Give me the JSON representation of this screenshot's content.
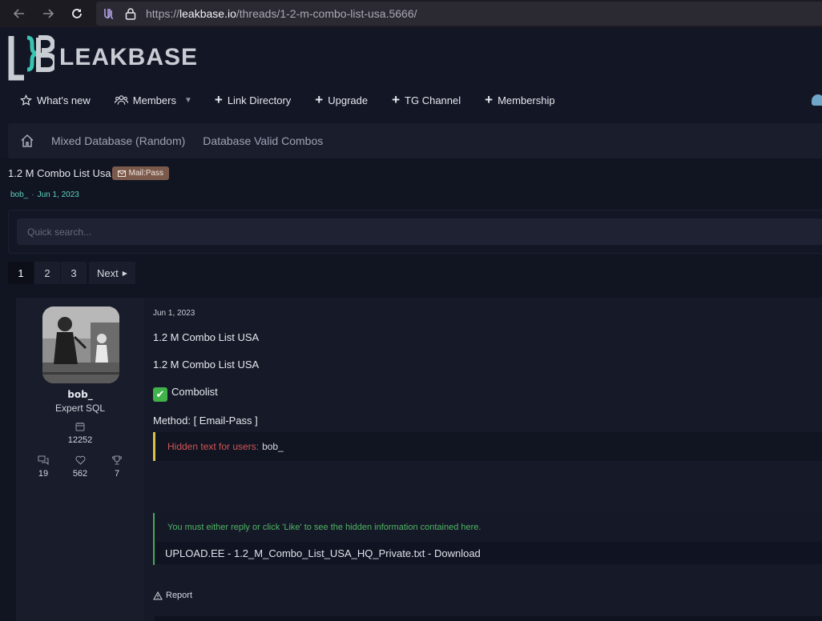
{
  "browser": {
    "url_host": "leakbase.io",
    "url_path": "/threads/1-2-m-combo-list-usa.5666/",
    "back_icon": "arrow-left-icon",
    "forward_icon": "arrow-right-icon",
    "reload_icon": "reload-icon"
  },
  "header": {
    "logo_text": "LEAKBASE",
    "nav": [
      {
        "label": "What's new",
        "icon": "star-icon"
      },
      {
        "label": "Members",
        "icon": "users-icon"
      },
      {
        "label": "Link Directory",
        "icon": "plus-icon"
      },
      {
        "label": "Upgrade",
        "icon": "plus-icon"
      },
      {
        "label": "TG Channel",
        "icon": "plus-icon"
      },
      {
        "label": "Membership",
        "icon": "plus-icon"
      }
    ]
  },
  "breadcrumb": {
    "items": [
      "Mixed Database (Random)",
      "Database Valid Combos"
    ]
  },
  "thread": {
    "title": "1.2 M Combo List Usa",
    "prefix": "Mail:Pass",
    "author": "bob_",
    "date": "Jun 1, 2023"
  },
  "search": {
    "placeholder": "Quick search..."
  },
  "pagination": {
    "pages": [
      "1",
      "2",
      "3"
    ],
    "next_label": "Next"
  },
  "post": {
    "user": {
      "name": "bob_",
      "title": "Expert SQL",
      "joined_stat": "12252",
      "messages": "19",
      "reactions": "562",
      "points": "7"
    },
    "date": "Jun 1, 2023",
    "line1": "1.2 M Combo List USA",
    "line2": "1.2 M Combo List USA",
    "line3": "Combolist",
    "method": "Method: [ Email-Pass ]",
    "hidden_label": "Hidden text for users:",
    "hidden_user": "bob_",
    "reply_notice": "You must either reply or click 'Like' to see the hidden information contained here.",
    "file_line": "UPLOAD.EE - 1.2_M_Combo_List_USA_HQ_Private.txt - Download",
    "report_label": "Report"
  },
  "colors": {
    "accent_teal": "#5fd3c0",
    "hidden_red": "#d15656",
    "reply_green": "#4fb564",
    "prefix_brown": "#7b5a4c"
  }
}
